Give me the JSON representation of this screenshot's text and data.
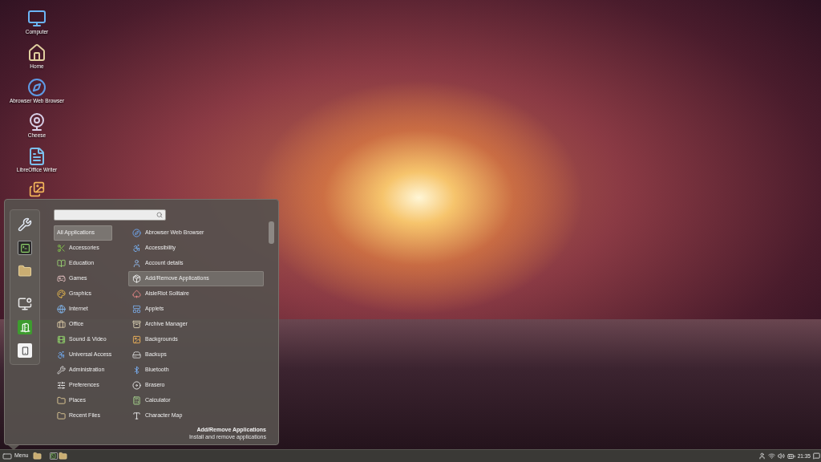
{
  "desktop": {
    "shortcuts": [
      {
        "label": "Computer"
      },
      {
        "label": "Home"
      },
      {
        "label": "Abrowser Web Browser"
      },
      {
        "label": "Cheese"
      },
      {
        "label": "LibreOffice Writer"
      }
    ]
  },
  "menu": {
    "categories": [
      {
        "label": "All Applications",
        "selected": true
      },
      {
        "label": "Accessories",
        "selected": false
      },
      {
        "label": "Education",
        "selected": false
      },
      {
        "label": "Games",
        "selected": false
      },
      {
        "label": "Graphics",
        "selected": false
      },
      {
        "label": "Internet",
        "selected": false
      },
      {
        "label": "Office",
        "selected": false
      },
      {
        "label": "Sound & Video",
        "selected": false
      },
      {
        "label": "Universal Access",
        "selected": false
      },
      {
        "label": "Administration",
        "selected": false
      },
      {
        "label": "Preferences",
        "selected": false
      },
      {
        "label": "Places",
        "selected": false
      },
      {
        "label": "Recent Files",
        "selected": false
      }
    ],
    "applications": [
      {
        "label": "Abrowser Web Browser",
        "selected": false
      },
      {
        "label": "Accessibility",
        "selected": false
      },
      {
        "label": "Account details",
        "selected": false
      },
      {
        "label": "Add/Remove Applications",
        "selected": true
      },
      {
        "label": "AisleRiot Solitaire",
        "selected": false
      },
      {
        "label": "Applets",
        "selected": false
      },
      {
        "label": "Archive Manager",
        "selected": false
      },
      {
        "label": "Backgrounds",
        "selected": false
      },
      {
        "label": "Backups",
        "selected": false
      },
      {
        "label": "Bluetooth",
        "selected": false
      },
      {
        "label": "Brasero",
        "selected": false
      },
      {
        "label": "Calculator",
        "selected": false
      },
      {
        "label": "Character Map",
        "selected": false
      }
    ],
    "description": {
      "title": "Add/Remove Applications",
      "text": "Install and remove applications"
    }
  },
  "taskbar": {
    "menu_label": "Menu",
    "clock": "21:35"
  }
}
